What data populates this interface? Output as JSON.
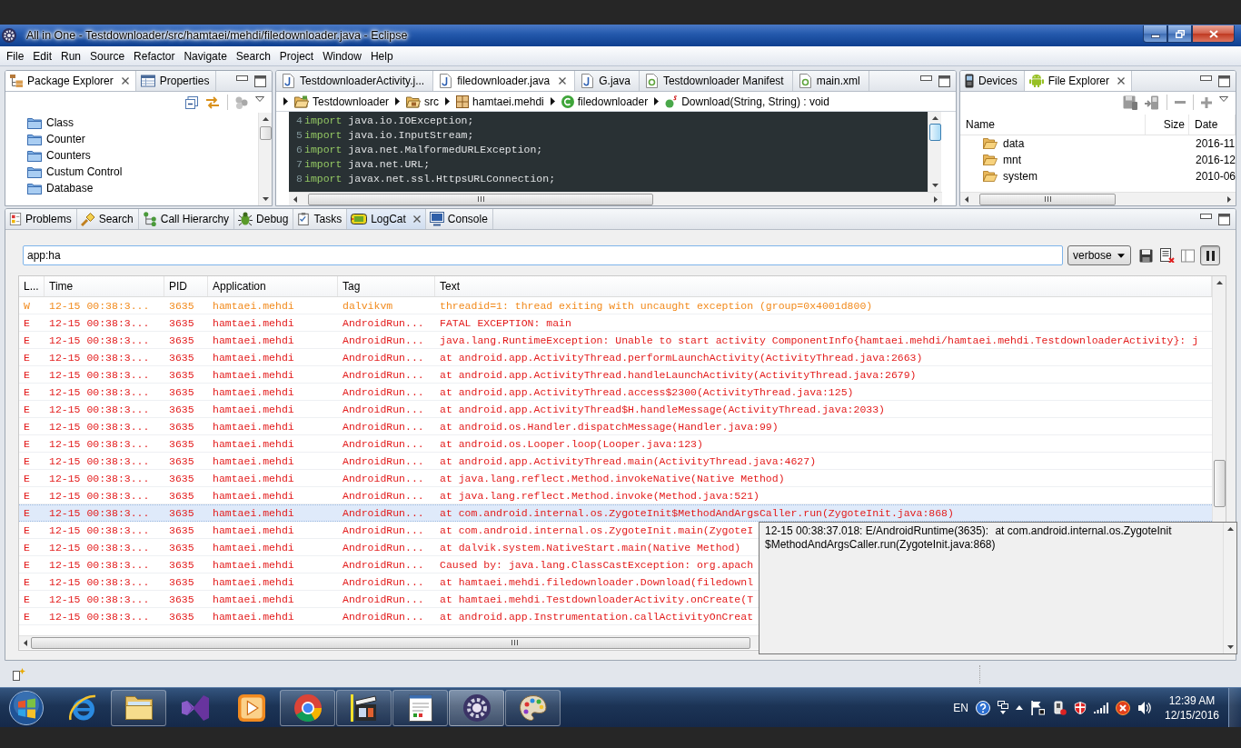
{
  "window": {
    "title": "All in One - Testdownloader/src/hamtaei/mehdi/filedownloader.java - Eclipse"
  },
  "menu": [
    "File",
    "Edit",
    "Run",
    "Source",
    "Refactor",
    "Navigate",
    "Search",
    "Project",
    "Window",
    "Help"
  ],
  "package_explorer": {
    "tabs": [
      {
        "label": "Package Explorer",
        "kind": "tree",
        "selected": true
      },
      {
        "label": "Properties",
        "kind": "table",
        "selected": false
      }
    ],
    "items": [
      "Class",
      "Counter",
      "Counters",
      "Custum Control",
      "Database"
    ]
  },
  "editor": {
    "tabs": [
      {
        "label": "TestdownloaderActivity.j...",
        "kind": "java",
        "selected": false
      },
      {
        "label": "filedownloader.java",
        "kind": "java",
        "selected": true
      },
      {
        "label": "G.java",
        "kind": "java",
        "selected": false
      },
      {
        "label": "Testdownloader Manifest",
        "kind": "android",
        "selected": false
      },
      {
        "label": "main.xml",
        "kind": "android",
        "selected": false
      }
    ],
    "breadcrumb": [
      {
        "label": "Testdownloader",
        "kind": "project"
      },
      {
        "label": "src",
        "kind": "source"
      },
      {
        "label": "hamtaei.mehdi",
        "kind": "package"
      },
      {
        "label": "filedownloader",
        "kind": "class"
      },
      {
        "label": "Download(String, String) : void",
        "kind": "method"
      }
    ],
    "lines": [
      {
        "number": "4",
        "keyword": "import",
        "text": "java.io.IOException;"
      },
      {
        "number": "5",
        "keyword": "import",
        "text": "java.io.InputStream;"
      },
      {
        "number": "6",
        "keyword": "import",
        "text": "java.net.MalformedURLException;"
      },
      {
        "number": "7",
        "keyword": "import",
        "text": "java.net.URL;"
      },
      {
        "number": "8",
        "keyword": "import",
        "text": "javax.net.ssl.HttpsURLConnection;"
      }
    ]
  },
  "file_explorer": {
    "tabs": [
      {
        "label": "Devices",
        "kind": "devices",
        "selected": false
      },
      {
        "label": "File Explorer",
        "kind": "android",
        "selected": true
      }
    ],
    "columns": [
      "Name",
      "Size",
      "Date"
    ],
    "rows": [
      {
        "name": "data",
        "date": "2016-11"
      },
      {
        "name": "mnt",
        "date": "2016-12"
      },
      {
        "name": "system",
        "date": "2010-06"
      }
    ]
  },
  "bottom_panel": {
    "tabs": [
      {
        "label": "Problems",
        "kind": "problems",
        "selected": false
      },
      {
        "label": "Search",
        "kind": "search",
        "selected": false
      },
      {
        "label": "Call Hierarchy",
        "kind": "hierarchy",
        "selected": false
      },
      {
        "label": "Debug",
        "kind": "debug",
        "selected": false
      },
      {
        "label": "Tasks",
        "kind": "tasks",
        "selected": false
      },
      {
        "label": "LogCat",
        "kind": "logcat",
        "selected": true
      },
      {
        "label": "Console",
        "kind": "console",
        "selected": false
      }
    ],
    "filter": {
      "value": "app:ha"
    },
    "log_level": "verbose",
    "paused": true,
    "columns": [
      "L...",
      "Time",
      "PID",
      "Application",
      "Tag",
      "Text"
    ],
    "rows": [
      {
        "level": "W",
        "time": "12-15 00:38:3...",
        "pid": "3635",
        "application": "hamtaei.mehdi",
        "tag": "dalvikvm",
        "text": "threadid=1: thread exiting with uncaught exception (group=0x4001d800)",
        "color": "#f28a1c",
        "selected": false
      },
      {
        "level": "E",
        "time": "12-15 00:38:3...",
        "pid": "3635",
        "application": "hamtaei.mehdi",
        "tag": "AndroidRun...",
        "text": "FATAL EXCEPTION: main",
        "color": "#e31b1b",
        "selected": false
      },
      {
        "level": "E",
        "time": "12-15 00:38:3...",
        "pid": "3635",
        "application": "hamtaei.mehdi",
        "tag": "AndroidRun...",
        "text": "java.lang.RuntimeException: Unable to start activity ComponentInfo{hamtaei.mehdi/hamtaei.mehdi.TestdownloaderActivity}: j",
        "color": "#e31b1b",
        "selected": false
      },
      {
        "level": "E",
        "time": "12-15 00:38:3...",
        "pid": "3635",
        "application": "hamtaei.mehdi",
        "tag": "AndroidRun...",
        "text": "at android.app.ActivityThread.performLaunchActivity(ActivityThread.java:2663)",
        "color": "#e31b1b",
        "selected": false
      },
      {
        "level": "E",
        "time": "12-15 00:38:3...",
        "pid": "3635",
        "application": "hamtaei.mehdi",
        "tag": "AndroidRun...",
        "text": "at android.app.ActivityThread.handleLaunchActivity(ActivityThread.java:2679)",
        "color": "#e31b1b",
        "selected": false
      },
      {
        "level": "E",
        "time": "12-15 00:38:3...",
        "pid": "3635",
        "application": "hamtaei.mehdi",
        "tag": "AndroidRun...",
        "text": "at android.app.ActivityThread.access$2300(ActivityThread.java:125)",
        "color": "#e31b1b",
        "selected": false
      },
      {
        "level": "E",
        "time": "12-15 00:38:3...",
        "pid": "3635",
        "application": "hamtaei.mehdi",
        "tag": "AndroidRun...",
        "text": "at android.app.ActivityThread$H.handleMessage(ActivityThread.java:2033)",
        "color": "#e31b1b",
        "selected": false
      },
      {
        "level": "E",
        "time": "12-15 00:38:3...",
        "pid": "3635",
        "application": "hamtaei.mehdi",
        "tag": "AndroidRun...",
        "text": "at android.os.Handler.dispatchMessage(Handler.java:99)",
        "color": "#e31b1b",
        "selected": false
      },
      {
        "level": "E",
        "time": "12-15 00:38:3...",
        "pid": "3635",
        "application": "hamtaei.mehdi",
        "tag": "AndroidRun...",
        "text": "at android.os.Looper.loop(Looper.java:123)",
        "color": "#e31b1b",
        "selected": false
      },
      {
        "level": "E",
        "time": "12-15 00:38:3...",
        "pid": "3635",
        "application": "hamtaei.mehdi",
        "tag": "AndroidRun...",
        "text": "at android.app.ActivityThread.main(ActivityThread.java:4627)",
        "color": "#e31b1b",
        "selected": false
      },
      {
        "level": "E",
        "time": "12-15 00:38:3...",
        "pid": "3635",
        "application": "hamtaei.mehdi",
        "tag": "AndroidRun...",
        "text": "at java.lang.reflect.Method.invokeNative(Native Method)",
        "color": "#e31b1b",
        "selected": false
      },
      {
        "level": "E",
        "time": "12-15 00:38:3...",
        "pid": "3635",
        "application": "hamtaei.mehdi",
        "tag": "AndroidRun...",
        "text": "at java.lang.reflect.Method.invoke(Method.java:521)",
        "color": "#e31b1b",
        "selected": false
      },
      {
        "level": "E",
        "time": "12-15 00:38:3...",
        "pid": "3635",
        "application": "hamtaei.mehdi",
        "tag": "AndroidRun...",
        "text": "at com.android.internal.os.ZygoteInit$MethodAndArgsCaller.run(ZygoteInit.java:868)",
        "color": "#e31b1b",
        "selected": true
      },
      {
        "level": "E",
        "time": "12-15 00:38:3...",
        "pid": "3635",
        "application": "hamtaei.mehdi",
        "tag": "AndroidRun...",
        "text": "at com.android.internal.os.ZygoteInit.main(ZygoteI",
        "color": "#e31b1b",
        "selected": false
      },
      {
        "level": "E",
        "time": "12-15 00:38:3...",
        "pid": "3635",
        "application": "hamtaei.mehdi",
        "tag": "AndroidRun...",
        "text": "at dalvik.system.NativeStart.main(Native Method)",
        "color": "#e31b1b",
        "selected": false
      },
      {
        "level": "E",
        "time": "12-15 00:38:3...",
        "pid": "3635",
        "application": "hamtaei.mehdi",
        "tag": "AndroidRun...",
        "text": "Caused by: java.lang.ClassCastException: org.apach",
        "color": "#e31b1b",
        "selected": false
      },
      {
        "level": "E",
        "time": "12-15 00:38:3...",
        "pid": "3635",
        "application": "hamtaei.mehdi",
        "tag": "AndroidRun...",
        "text": "at hamtaei.mehdi.filedownloader.Download(filedownl",
        "color": "#e31b1b",
        "selected": false
      },
      {
        "level": "E",
        "time": "12-15 00:38:3...",
        "pid": "3635",
        "application": "hamtaei.mehdi",
        "tag": "AndroidRun...",
        "text": "at hamtaei.mehdi.TestdownloaderActivity.onCreate(T",
        "color": "#e31b1b",
        "selected": false
      },
      {
        "level": "E",
        "time": "12-15 00:38:3...",
        "pid": "3635",
        "application": "hamtaei.mehdi",
        "tag": "AndroidRun...",
        "text": "at android.app.Instrumentation.callActivityOnCreat",
        "color": "#e31b1b",
        "selected": false
      }
    ],
    "tooltip": {
      "lines": [
        "12-15 00:38:37.018: E/AndroidRuntime(3635):\tat com.android.internal.os.ZygoteInit",
        "$MethodAndArgsCaller.run(ZygoteInit.java:868)"
      ]
    }
  },
  "taskbar": {
    "buttons": [
      {
        "kind": "browser",
        "running": false,
        "selected": false
      },
      {
        "kind": "folder",
        "running": true,
        "selected": false
      },
      {
        "kind": "studio",
        "running": false,
        "selected": false
      },
      {
        "kind": "player",
        "running": false,
        "selected": false
      },
      {
        "kind": "web",
        "running": true,
        "selected": false
      },
      {
        "kind": "clapper",
        "running": true,
        "selected": false
      },
      {
        "kind": "document",
        "running": true,
        "selected": false
      },
      {
        "kind": "ide",
        "running": true,
        "selected": true
      },
      {
        "kind": "paint",
        "running": true,
        "selected": false
      }
    ]
  },
  "tray": {
    "language": "EN",
    "time": "12:39 AM",
    "date": "12/15/2016"
  }
}
